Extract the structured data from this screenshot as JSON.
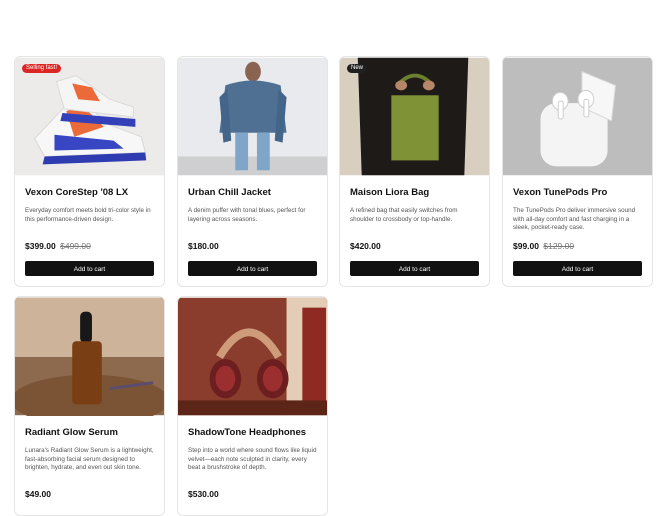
{
  "products": [
    {
      "badge": "Selling fast!",
      "title": "Vexon CoreStep '08 LX",
      "description": "Everyday comfort meets bold tri-color style in this performance-driven design.",
      "price": "$399.00",
      "was_price": "$499.00",
      "button": "Add to cart"
    },
    {
      "title": "Urban Chill Jacket",
      "description": "A denim puffer with tonal blues, perfect for layering across seasons.",
      "price": "$180.00",
      "button": "Add to cart"
    },
    {
      "badge": "New",
      "title": "Maison Liora Bag",
      "description": "A refined bag that easily switches from shoulder to crossbody or top-handle.",
      "price": "$420.00",
      "button": "Add to cart"
    },
    {
      "title": "Vexon TunePods Pro",
      "description": "The TunePods Pro deliver immersive sound with all-day comfort and fast charging in a sleek, pocket-ready case.",
      "price": "$99.00",
      "was_price": "$129.00",
      "button": "Add to cart"
    },
    {
      "title": "Radiant Glow Serum",
      "description": "Lunara's Radiant Glow Serum is a lightweight, fast-absorbing facial serum designed to brighten, hydrate, and even out skin tone.",
      "price": "$49.00"
    },
    {
      "title": "ShadowTone Headphones",
      "description": "Step into a world where sound flows like liquid velvet—each note sculpted in clarity, every beat a brushstroke of depth.",
      "price": "$530.00"
    }
  ]
}
